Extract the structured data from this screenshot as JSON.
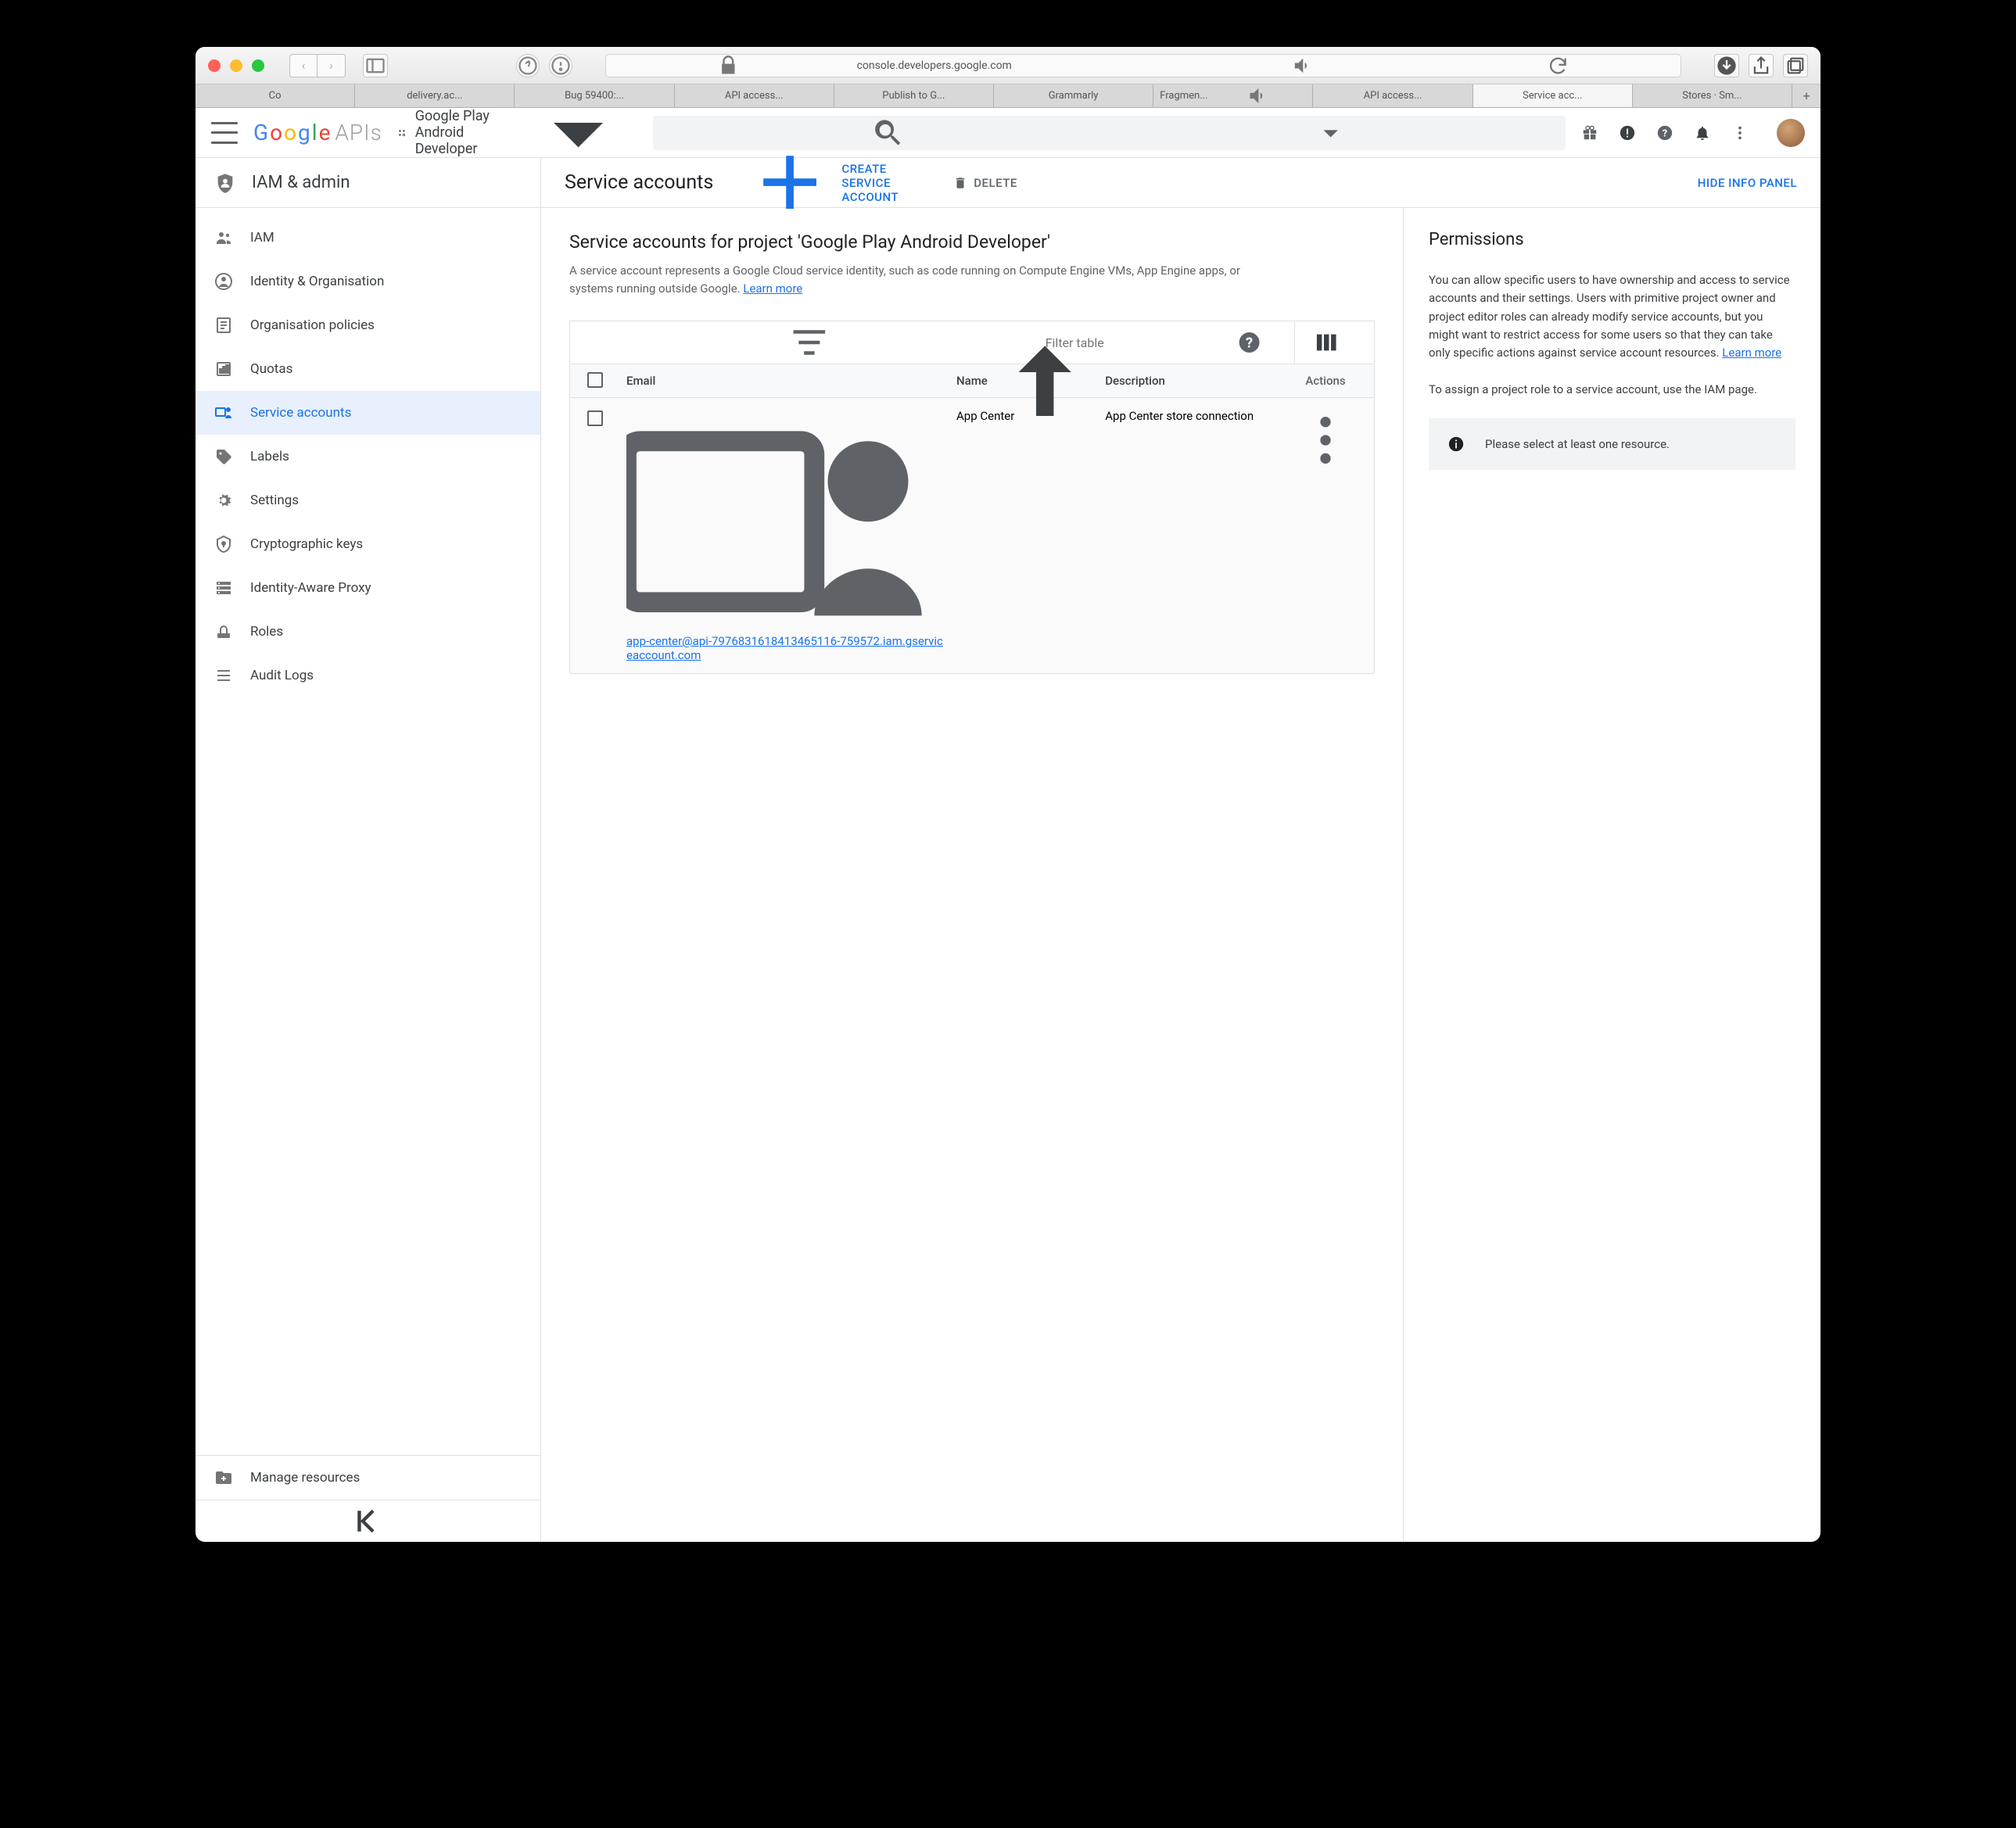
{
  "browser": {
    "url": "console.developers.google.com",
    "tabs": [
      "Co",
      "delivery.ac...",
      "Bug 59400:...",
      "API access...",
      "Publish to G...",
      "Grammarly",
      "Fragmen...",
      "API access...",
      "Service acc...",
      "Stores · Sm..."
    ],
    "active_tab_index": 8
  },
  "header": {
    "logo_text_apis": "APIs",
    "project_name": "Google Play Android Developer"
  },
  "sidebar": {
    "section_title": "IAM & admin",
    "items": [
      {
        "label": "IAM",
        "icon": "people"
      },
      {
        "label": "Identity & Organisation",
        "icon": "person-circle"
      },
      {
        "label": "Organisation policies",
        "icon": "list-doc"
      },
      {
        "label": "Quotas",
        "icon": "quota"
      },
      {
        "label": "Service accounts",
        "icon": "service-account"
      },
      {
        "label": "Labels",
        "icon": "tag"
      },
      {
        "label": "Settings",
        "icon": "gear"
      },
      {
        "label": "Cryptographic keys",
        "icon": "crypto"
      },
      {
        "label": "Identity-Aware Proxy",
        "icon": "proxy"
      },
      {
        "label": "Roles",
        "icon": "roles"
      },
      {
        "label": "Audit Logs",
        "icon": "logs"
      }
    ],
    "active_index": 4,
    "footer_label": "Manage resources"
  },
  "toolbar": {
    "title": "Service accounts",
    "create_label": "CREATE SERVICE ACCOUNT",
    "delete_label": "DELETE",
    "hide_panel_label": "HIDE INFO PANEL"
  },
  "content": {
    "heading": "Service accounts for project 'Google Play Android Developer'",
    "description": "A service account represents a Google Cloud service identity, such as code running on Compute Engine VMs, App Engine apps, or systems running outside Google. ",
    "learn_more": "Learn more",
    "filter_placeholder": "Filter table",
    "columns": {
      "email": "Email",
      "name": "Name",
      "description": "Description",
      "actions": "Actions"
    },
    "rows": [
      {
        "email": "app-center@api-7976831618413465116-759572.iam.gserviceaccount.com",
        "name": "App Center",
        "description": "App Center store connection"
      }
    ]
  },
  "panel": {
    "title": "Permissions",
    "p1": "You can allow specific users to have ownership and access to service accounts and their settings. Users with primitive project owner and project editor roles can already modify service accounts, but you might want to restrict access for some users so that they can take only specific actions against service account resources. ",
    "learn_more": "Learn more",
    "p2": "To assign a project role to a service account, use the IAM page.",
    "alert": "Please select at least one resource."
  }
}
